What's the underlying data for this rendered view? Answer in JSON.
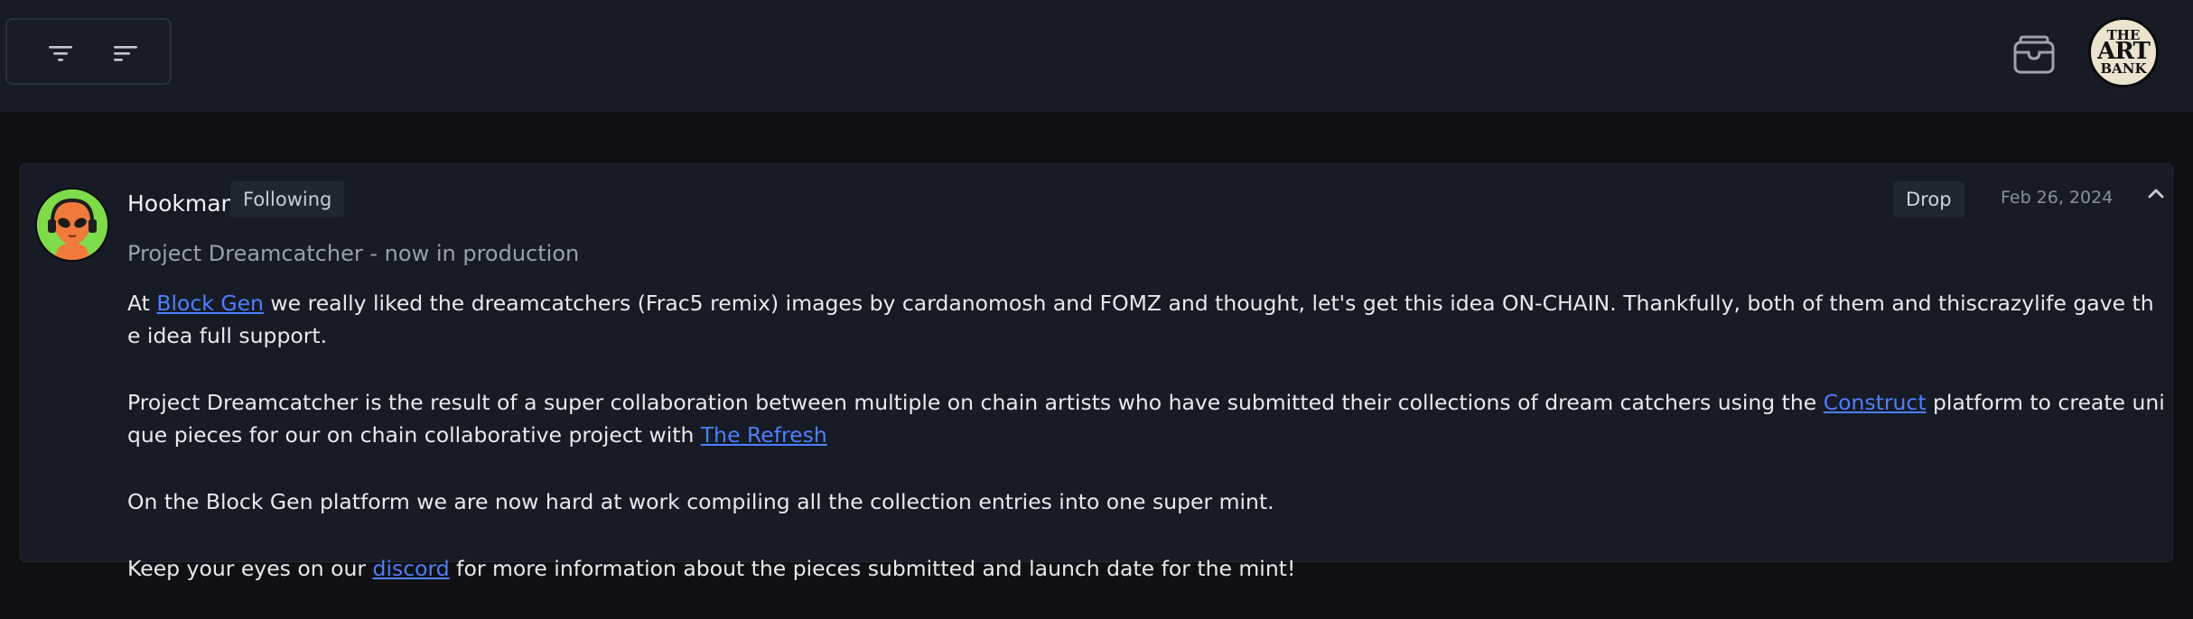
{
  "toolbar": {
    "filter_icon": "filter-funnel-icon",
    "sort_icon": "sort-lines-icon",
    "wallet_icon": "wallet-icon"
  },
  "brand": {
    "logo_line1": "THE",
    "logo_line2": "ART",
    "logo_line3": "BANK"
  },
  "post": {
    "author": "Hookman",
    "follow_label": "Following",
    "type_label": "Drop",
    "date": "Feb 26, 2024",
    "title": "Project Dreamcatcher - now in production",
    "p1": {
      "pre": "At ",
      "link": "Block Gen",
      "post": " we really liked the dreamcatchers (Frac5 remix) images by cardanomosh and FOMZ and thought, let's get this idea ON-CHAIN. Thankfully, both of them and thiscrazylife gave the idea full support."
    },
    "p2": {
      "pre": "Project Dreamcatcher is the result of a super collaboration between multiple on chain artists who have submitted their collections of dream catchers using the ",
      "link1": "Construct",
      "mid": " platform to create unique pieces for our on chain collaborative project with ",
      "link2": "The Refresh"
    },
    "p3": "On the Block Gen platform we are now hard at work compiling all the collection entries into one super mint.",
    "p4": {
      "pre": "Keep your eyes on our ",
      "link": "discord",
      "post": " for more information about the pieces submitted and launch date for the mint!"
    }
  },
  "colors": {
    "background": "#0f1114",
    "panel": "#161b25",
    "link": "#4f7fff",
    "avatar_bg": "#7edb49"
  }
}
